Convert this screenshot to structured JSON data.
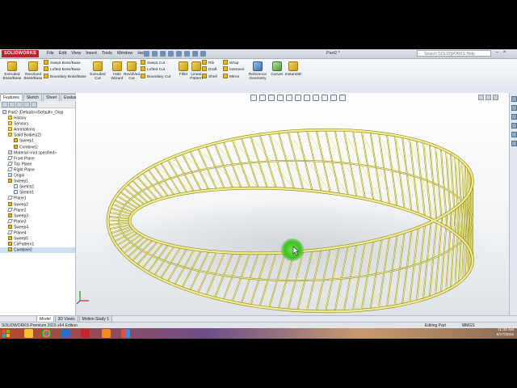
{
  "app": {
    "logo_text": "SOLIDWORKS",
    "menu": [
      "File",
      "Edit",
      "View",
      "Insert",
      "Tools",
      "Window",
      "Help"
    ],
    "document_title": "Part2 *",
    "search_placeholder": "Search SOLIDWORKS Help"
  },
  "command_manager": {
    "large_tools": [
      {
        "label": "Extruded\nBoss/Base",
        "name": "extruded-boss-base-button"
      },
      {
        "label": "Revolved\nBoss/Base",
        "name": "revolved-boss-base-button"
      },
      {
        "label": "Extruded\nCut",
        "name": "extruded-cut-button"
      },
      {
        "label": "Hole\nWizard",
        "name": "hole-wizard-button"
      },
      {
        "label": "Revolved\nCut",
        "name": "revolved-cut-button"
      },
      {
        "label": "Fillet",
        "name": "fillet-button"
      },
      {
        "label": "Linear\nPattern",
        "name": "linear-pattern-button"
      },
      {
        "label": "Reference\nGeometry",
        "name": "reference-geometry-button"
      },
      {
        "label": "Curves",
        "name": "curves-button"
      },
      {
        "label": "Instant3D",
        "name": "instant3d-button"
      }
    ],
    "small_tools": {
      "swept_boss": "Swept Boss/Base",
      "lofted_boss": "Lofted Boss/Base",
      "boundary_boss": "Boundary Boss/Base",
      "swept_cut": "Swept Cut",
      "lofted_cut": "Lofted Cut",
      "boundary_cut": "Boundary Cut",
      "rib": "Rib",
      "draft": "Draft",
      "shell": "Shell",
      "wrap": "Wrap",
      "intersect": "Intersect",
      "mirror": "Mirror"
    },
    "tabs": [
      "Features",
      "Sketch",
      "Sheet Metal",
      "Evaluate"
    ]
  },
  "feature_tree": [
    {
      "label": "Part2  (Default<<Default>_Disp",
      "indent": 0,
      "kind": "part"
    },
    {
      "label": "History",
      "indent": 1,
      "kind": "folder"
    },
    {
      "label": "Sensors",
      "indent": 1,
      "kind": "folder"
    },
    {
      "label": "Annotations",
      "indent": 1,
      "kind": "folder"
    },
    {
      "label": "Solid Bodies(2)",
      "indent": 1,
      "kind": "folder"
    },
    {
      "label": "Sweep1",
      "indent": 2,
      "kind": "feat"
    },
    {
      "label": "Combine2",
      "indent": 2,
      "kind": "feat"
    },
    {
      "label": "Material <not specified>",
      "indent": 1,
      "kind": "other"
    },
    {
      "label": "Front Plane",
      "indent": 1,
      "kind": "plane"
    },
    {
      "label": "Top Plane",
      "indent": 1,
      "kind": "plane"
    },
    {
      "label": "Right Plane",
      "indent": 1,
      "kind": "plane"
    },
    {
      "label": "Origin",
      "indent": 1,
      "kind": "other"
    },
    {
      "label": "Sweep1",
      "indent": 1,
      "kind": "feat"
    },
    {
      "label": "Sketch2",
      "indent": 2,
      "kind": "sketch"
    },
    {
      "label": "Sketch1",
      "indent": 2,
      "kind": "sketch"
    },
    {
      "label": "Plane1",
      "indent": 1,
      "kind": "plane"
    },
    {
      "label": "Sweep2",
      "indent": 1,
      "kind": "feat"
    },
    {
      "label": "Plane2",
      "indent": 1,
      "kind": "plane"
    },
    {
      "label": "Sweep3",
      "indent": 1,
      "kind": "feat"
    },
    {
      "label": "Plane3",
      "indent": 1,
      "kind": "plane"
    },
    {
      "label": "Sweep4",
      "indent": 1,
      "kind": "feat"
    },
    {
      "label": "Plane4",
      "indent": 1,
      "kind": "plane"
    },
    {
      "label": "Sweep5",
      "indent": 1,
      "kind": "feat"
    },
    {
      "label": "CirPattern1",
      "indent": 1,
      "kind": "feat"
    },
    {
      "label": "Combine2",
      "indent": 1,
      "kind": "feat"
    }
  ],
  "bottom_tabs": [
    "Model",
    "3D Views",
    "Motion Study 1"
  ],
  "status": {
    "edition": "SOLIDWORKS Premium 2015 x64 Edition",
    "mode": "Editing Part",
    "units": "MMGS"
  },
  "taskbar": {
    "time": "11:32 AM",
    "date": "8/17/2015"
  },
  "colors": {
    "model_yellow": "#f2ec8a",
    "model_edge": "#8a8220",
    "cursor_green": "#3cc21e",
    "brand_red": "#b8252a"
  }
}
